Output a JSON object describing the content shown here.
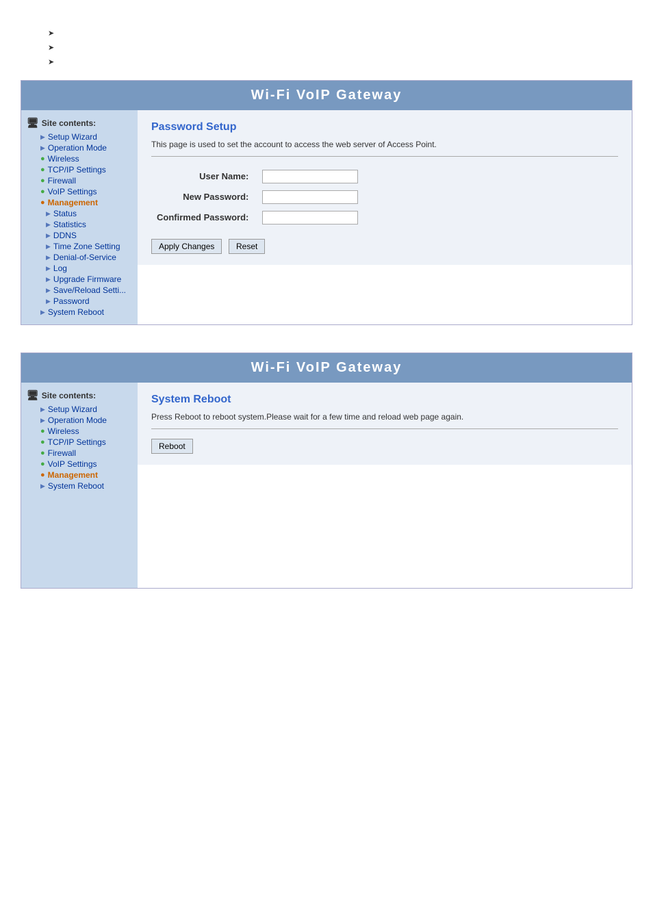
{
  "bullets": [
    "",
    "",
    ""
  ],
  "panel1": {
    "header": "Wi-Fi  VoIP  Gateway",
    "sidebar": {
      "title": "Site contents:",
      "items": [
        {
          "label": "Setup Wizard",
          "type": "blue",
          "level": 1
        },
        {
          "label": "Operation Mode",
          "type": "blue",
          "level": 1
        },
        {
          "label": "Wireless",
          "type": "green",
          "level": 1
        },
        {
          "label": "TCP/IP Settings",
          "type": "green",
          "level": 1
        },
        {
          "label": "Firewall",
          "type": "green",
          "level": 1
        },
        {
          "label": "VoIP Settings",
          "type": "green",
          "level": 1
        },
        {
          "label": "Management",
          "type": "orange",
          "level": 1,
          "active": true
        },
        {
          "label": "Status",
          "type": "blue",
          "level": 2
        },
        {
          "label": "Statistics",
          "type": "blue",
          "level": 2
        },
        {
          "label": "DDNS",
          "type": "blue",
          "level": 2
        },
        {
          "label": "Time Zone Setting",
          "type": "blue",
          "level": 2
        },
        {
          "label": "Denial-of-Service",
          "type": "blue",
          "level": 2
        },
        {
          "label": "Log",
          "type": "blue",
          "level": 2
        },
        {
          "label": "Upgrade Firmware",
          "type": "blue",
          "level": 2
        },
        {
          "label": "Save/Reload Settings",
          "type": "blue",
          "level": 2
        },
        {
          "label": "Password",
          "type": "blue",
          "level": 2
        },
        {
          "label": "System Reboot",
          "type": "blue",
          "level": 1
        }
      ]
    },
    "content": {
      "title": "Password Setup",
      "description": "This page is used to set the account to access the web server of Access Point.",
      "fields": [
        {
          "label": "User Name:",
          "type": "text",
          "value": ""
        },
        {
          "label": "New Password:",
          "type": "password",
          "value": ""
        },
        {
          "label": "Confirmed Password:",
          "type": "password",
          "value": ""
        }
      ],
      "buttons": [
        "Apply Changes",
        "Reset"
      ]
    }
  },
  "panel2": {
    "header": "Wi-Fi  VoIP  Gateway",
    "sidebar": {
      "title": "Site contents:",
      "items": [
        {
          "label": "Setup Wizard",
          "type": "blue",
          "level": 1
        },
        {
          "label": "Operation Mode",
          "type": "blue",
          "level": 1
        },
        {
          "label": "Wireless",
          "type": "green",
          "level": 1
        },
        {
          "label": "TCP/IP Settings",
          "type": "green",
          "level": 1
        },
        {
          "label": "Firewall",
          "type": "green",
          "level": 1
        },
        {
          "label": "VoIP Settings",
          "type": "green",
          "level": 1
        },
        {
          "label": "Management",
          "type": "orange",
          "level": 1,
          "active": true
        },
        {
          "label": "System Reboot",
          "type": "blue",
          "level": 1
        }
      ]
    },
    "content": {
      "title": "System Reboot",
      "description": "Press Reboot to reboot system.Please wait for a few time and reload web page again.",
      "buttons": [
        "Reboot"
      ]
    }
  }
}
